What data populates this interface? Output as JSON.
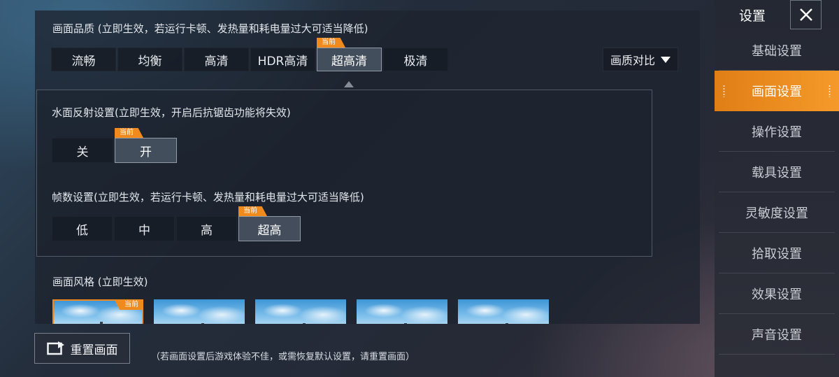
{
  "quality": {
    "title": "画面品质 (立即生效，若运行卡顿、发热量和耗电量过大可适当降低)",
    "options": [
      "流畅",
      "均衡",
      "高清",
      "HDR高清",
      "超高清",
      "极清"
    ],
    "selected": "超高清",
    "current_tag": "当前",
    "compare_label": "画质对比"
  },
  "water": {
    "title": "水面反射设置(立即生效，开启后抗锯齿功能将失效)",
    "options": [
      "关",
      "开"
    ],
    "selected": "开",
    "current_tag": "当前"
  },
  "fps": {
    "title": "帧数设置(立即生效，若运行卡顿、发热量和耗电量过大可适当降低)",
    "options": [
      "低",
      "中",
      "高",
      "超高"
    ],
    "selected": "超高",
    "current_tag": "当前"
  },
  "style": {
    "title": "画面风格 (立即生效)",
    "current_tag": "当前",
    "thumbnails": 5,
    "selected_index": 0
  },
  "footer": {
    "reset_label": "重置画面",
    "hint": "（若画面设置后游戏体验不佳，或需恢复默认设置，请重置画面）"
  },
  "sidebar": {
    "title": "设置",
    "items": [
      "基础设置",
      "画面设置",
      "操作设置",
      "载具设置",
      "灵敏度设置",
      "拾取设置",
      "效果设置",
      "声音设置"
    ],
    "active": "画面设置"
  },
  "colors": {
    "accent": "#f08a1c",
    "panel": "#1e2430",
    "sky": "#7fc0ec"
  }
}
